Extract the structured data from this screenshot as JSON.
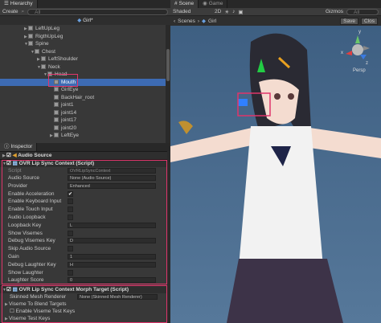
{
  "hierarchy": {
    "tab": "Hierarchy",
    "create": "Create",
    "search": "All",
    "root": "Girl*",
    "items": [
      "LeftUpLeg",
      "RigthUpLeg",
      "Spine",
      "Chest",
      "LeftShoulder",
      "Neck",
      "Head",
      "Mouth",
      "GirlEye",
      "BackHair_root",
      "joint1",
      "joint14",
      "joint17",
      "joint20",
      "LeftEye"
    ]
  },
  "scene": {
    "tab_scene": "Scene",
    "tab_game": "Game",
    "shaded": "Shaded",
    "mode2d": "2D",
    "gizmos": "Gizmos",
    "search": "All",
    "breadcrumb_scenes": "Scenes",
    "breadcrumb_girl": "Girl",
    "save": "Save",
    "close": "Clos",
    "persp": "Persp",
    "gizmo_y": "y",
    "gizmo_x": "x",
    "gizmo_z": "z"
  },
  "inspector": {
    "tab": "Inspector",
    "audio_source": "Audio Source",
    "lipsync_header": "OVR Lip Sync Context (Script)",
    "script_label": "Script",
    "script_value": "OVRLipSyncContext",
    "props": [
      {
        "label": "Audio Source",
        "value": "None (Audio Source)"
      },
      {
        "label": "Provider",
        "value": "Enhanced"
      },
      {
        "label": "Enable Acceleration",
        "check": "✔"
      },
      {
        "label": "Enable Keyboard Input",
        "check": ""
      },
      {
        "label": "Enable Touch Input",
        "check": ""
      },
      {
        "label": "Audio Loopback",
        "check": ""
      },
      {
        "label": "Loopback Key",
        "value": "L"
      },
      {
        "label": "Show Visemes",
        "check": ""
      },
      {
        "label": "Debug Visemes Key",
        "value": "D"
      },
      {
        "label": "Skip Audio Source",
        "check": ""
      },
      {
        "label": "Gain",
        "value": "1"
      },
      {
        "label": "Debug Laughter Key",
        "value": "H"
      },
      {
        "label": "Show Laughter",
        "check": ""
      },
      {
        "label": "Laughter Score",
        "value": "0"
      }
    ],
    "morph_header": "OVR Lip Sync Context Morph Target (Script)",
    "skinned_label": "Skinned Mesh Renderer",
    "skinned_value": "None (Skinned Mesh Renderer)",
    "viseme_blend": "Viseme To Blend Targets",
    "enable_viseme_test": "Enable Viseme Test Keys",
    "viseme_test_keys": "Viseme Test Keys"
  },
  "colors": {
    "accent": "#e0356b",
    "selection": "#3d6bb3",
    "viewport": "#4a6a8a"
  }
}
